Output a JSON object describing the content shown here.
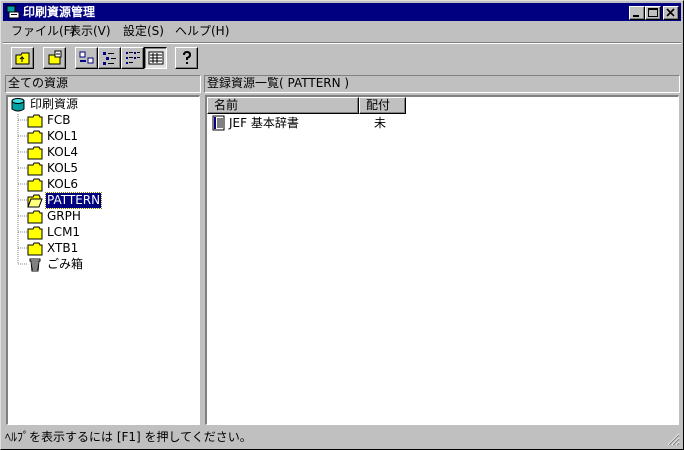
{
  "window": {
    "title": "印刷資源管理"
  },
  "menu": [
    {
      "label": "ファイル(F)"
    },
    {
      "label": "表示(V)"
    },
    {
      "label": "設定(S)"
    },
    {
      "label": "ヘルプ(H)"
    }
  ],
  "toolbar": {
    "buttons": [
      {
        "icon": "up-folder-icon"
      },
      {
        "icon": "properties-icon"
      },
      {
        "icon": "large-icons-icon"
      },
      {
        "icon": "small-icons-icon"
      },
      {
        "icon": "list-view-icon"
      },
      {
        "icon": "details-view-icon",
        "pressed": true
      },
      {
        "icon": "help-icon"
      }
    ]
  },
  "left_pane": {
    "header": "全ての資源",
    "root": "印刷資源",
    "items": [
      {
        "label": "FCB",
        "icon": "folder-icon"
      },
      {
        "label": "KOL1",
        "icon": "folder-icon"
      },
      {
        "label": "KOL4",
        "icon": "folder-icon"
      },
      {
        "label": "KOL5",
        "icon": "folder-icon"
      },
      {
        "label": "KOL6",
        "icon": "folder-icon"
      },
      {
        "label": "PATTERN",
        "icon": "open-folder-icon",
        "selected": true
      },
      {
        "label": "GRPH",
        "icon": "folder-icon"
      },
      {
        "label": "LCM1",
        "icon": "folder-icon"
      },
      {
        "label": "XTB1",
        "icon": "folder-icon"
      },
      {
        "label": "ごみ箱",
        "icon": "trash-icon"
      }
    ]
  },
  "right_pane": {
    "header": "登録資源一覧( PATTERN )",
    "columns": [
      "名前",
      "配付"
    ],
    "rows": [
      {
        "name": "JEF 基本辞書",
        "distribution": "未"
      }
    ]
  },
  "status": {
    "text": "ﾍﾙﾌﾟを表示するには [F1] を押してください。"
  },
  "colors": {
    "title_bar": "#000080",
    "face": "#c0c0c0",
    "selection": "#000080",
    "folder": "#ffff00"
  }
}
